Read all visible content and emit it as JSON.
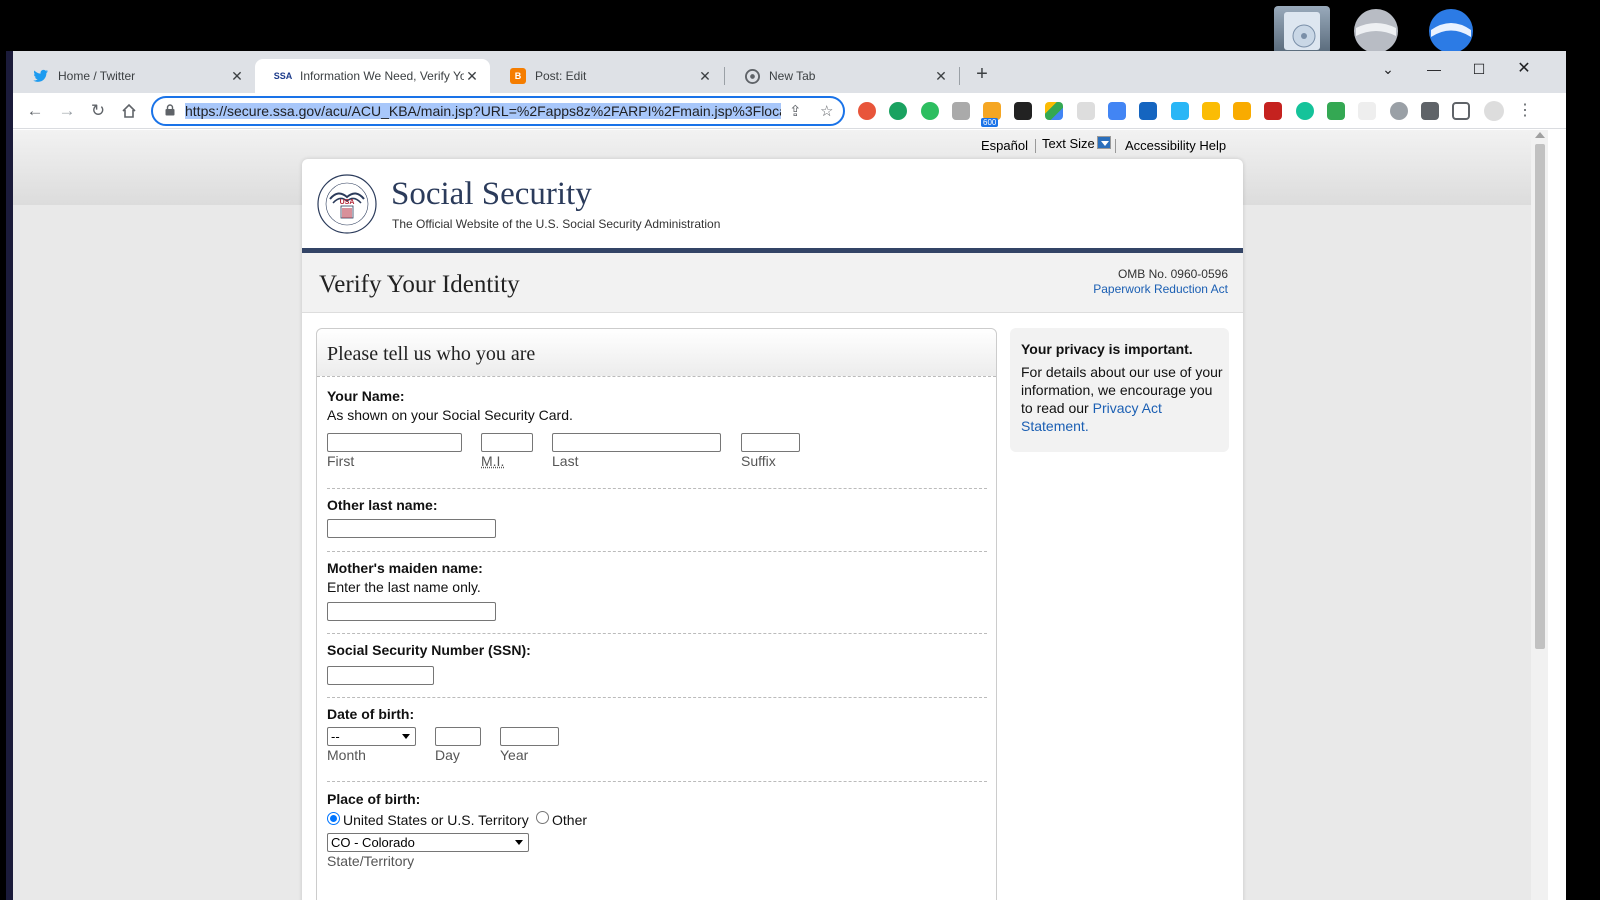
{
  "tabs": [
    {
      "title": "Home / Twitter",
      "icon": "twitter-icon"
    },
    {
      "title": "Information We Need, Verify You",
      "icon": "ssa-icon",
      "favicon_text": "SSA"
    },
    {
      "title": "Post: Edit",
      "icon": "blogger-icon",
      "favicon_text": "B"
    },
    {
      "title": "New Tab",
      "icon": "chrome-icon"
    }
  ],
  "address": {
    "url": "https://secure.ssa.gov/acu/ACU_KBA/main.jsp?URL=%2Fapps8z%2FARPI%2Fmain.jsp%3Flocale%3D"
  },
  "extensions": [
    {
      "label": "600"
    }
  ],
  "utility": {
    "espanol": "Español",
    "text_size": "Text Size",
    "accessibility": "Accessibility Help"
  },
  "brand": {
    "title": "Social Security",
    "subtitle": "The Official Website of the U.S. Social Security Administration",
    "seal_text": "USA"
  },
  "page": {
    "title": "Verify Your Identity",
    "omb": "OMB No. 0960-0596",
    "paperwork": "Paperwork Reduction Act"
  },
  "form": {
    "heading": "Please tell us who you are",
    "name_label": "Your Name:",
    "name_hint": "As shown on your Social Security Card.",
    "first": "First",
    "mi": "M.I.",
    "last": "Last",
    "suffix": "Suffix",
    "other_last_label": "Other last name:",
    "maiden_label": "Mother's maiden name:",
    "maiden_hint": "Enter the last name only.",
    "ssn_label": "Social Security Number (SSN):",
    "dob_label": "Date of birth:",
    "month_value": "--",
    "month": "Month",
    "day": "Day",
    "year": "Year",
    "pob_label": "Place of birth:",
    "pob_us": "United States or U.S. Territory",
    "pob_other": "Other",
    "state_value": "CO - Colorado",
    "state_label": "State/Territory"
  },
  "privacy": {
    "title": "Your privacy is important.",
    "body": "For details about our use of your information, we encourage you to read our ",
    "link": "Privacy Act Statement."
  },
  "colors": {
    "accent": "#1a73e8",
    "ssa_navy": "#334466",
    "link": "#1b5fb3"
  }
}
